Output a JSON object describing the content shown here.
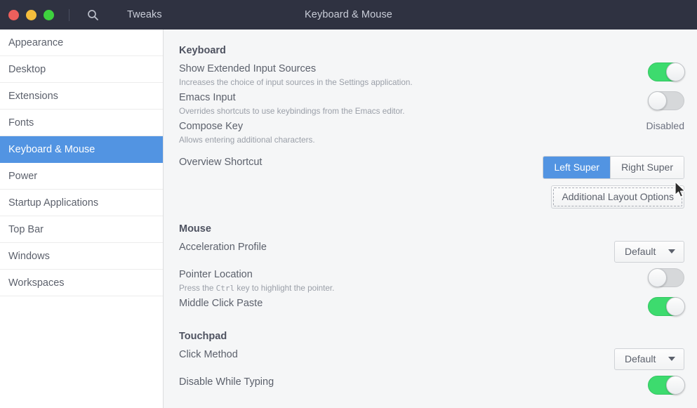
{
  "titlebar": {
    "app_name": "Tweaks",
    "window_title": "Keyboard & Mouse",
    "search_icon": "search-icon",
    "buttons": {
      "close": "close-window-button",
      "minimize": "minimize-window-button",
      "maximize": "maximize-window-button"
    },
    "colors": {
      "background": "#2f3241",
      "close": "#ed5f5c",
      "minimize": "#f5bd3c",
      "maximize": "#3ed13e",
      "title_text": "#c9cdd8"
    }
  },
  "sidebar": {
    "items": [
      {
        "label": "Appearance",
        "selected": false
      },
      {
        "label": "Desktop",
        "selected": false
      },
      {
        "label": "Extensions",
        "selected": false
      },
      {
        "label": "Fonts",
        "selected": false
      },
      {
        "label": "Keyboard & Mouse",
        "selected": true
      },
      {
        "label": "Power",
        "selected": false
      },
      {
        "label": "Startup Applications",
        "selected": false
      },
      {
        "label": "Top Bar",
        "selected": false
      },
      {
        "label": "Windows",
        "selected": false
      },
      {
        "label": "Workspaces",
        "selected": false
      }
    ],
    "colors": {
      "background": "#ffffff",
      "selected_background": "#5294e2",
      "selected_text": "#ffffff",
      "text": "#5c616c"
    }
  },
  "content": {
    "keyboard": {
      "section_title": "Keyboard",
      "rows": {
        "show_extended_input_sources": {
          "title": "Show Extended Input Sources",
          "subtitle": "Increases the choice of input sources in the Settings application.",
          "toggle_state": "on"
        },
        "emacs_input": {
          "title": "Emacs Input",
          "subtitle": "Overrides shortcuts to use keybindings from the Emacs editor.",
          "toggle_state": "off"
        },
        "compose_key": {
          "title": "Compose Key",
          "subtitle": "Allows entering additional characters.",
          "value": "Disabled"
        },
        "overview_shortcut": {
          "title": "Overview Shortcut",
          "options": [
            {
              "label": "Left Super",
              "active": true
            },
            {
              "label": "Right Super",
              "active": false
            }
          ]
        },
        "additional_layout_options": {
          "label": "Additional Layout Options",
          "focused": true
        }
      }
    },
    "mouse": {
      "section_title": "Mouse",
      "rows": {
        "acceleration_profile": {
          "title": "Acceleration Profile",
          "value": "Default"
        },
        "pointer_location": {
          "title": "Pointer Location",
          "subtitle_prefix": "Press the ",
          "subtitle_key": "Ctrl",
          "subtitle_suffix": " key to highlight the pointer.",
          "toggle_state": "off"
        },
        "middle_click_paste": {
          "title": "Middle Click Paste",
          "toggle_state": "on"
        }
      }
    },
    "touchpad": {
      "section_title": "Touchpad",
      "rows": {
        "click_method": {
          "title": "Click Method",
          "value": "Default"
        },
        "disable_while_typing": {
          "title": "Disable While Typing",
          "toggle_state": "on"
        }
      }
    },
    "colors": {
      "background": "#f5f6f7",
      "heading_text": "#4e5260",
      "label_text": "#5c616c",
      "subtitle_text": "#9a9fa8",
      "toggle_on": "#3ddb6e",
      "toggle_off": "#d6d8da",
      "accent": "#5294e2"
    }
  }
}
